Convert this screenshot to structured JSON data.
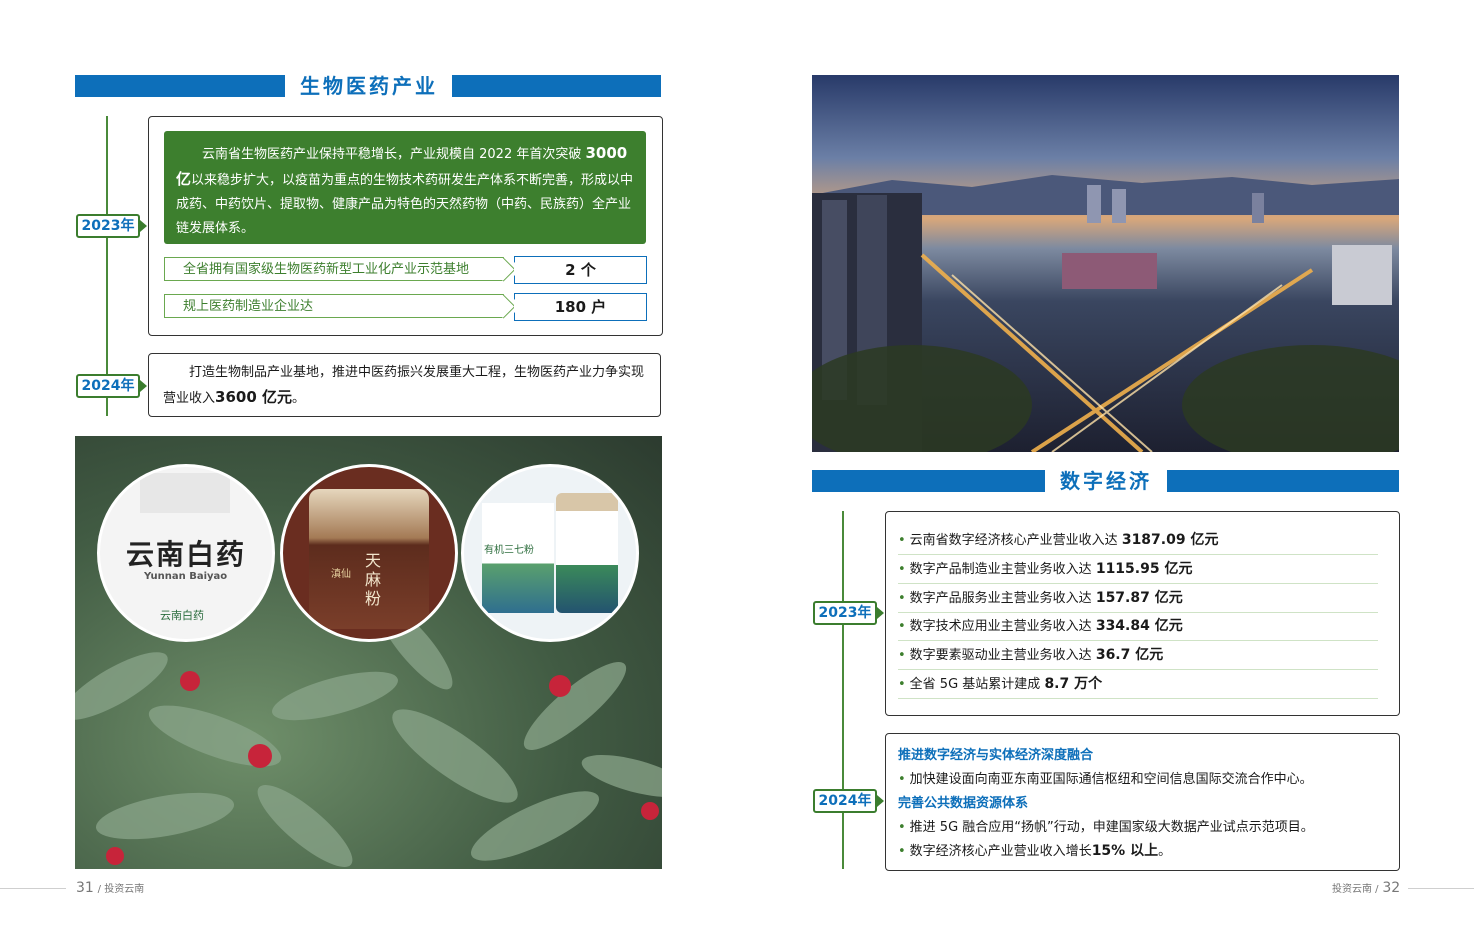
{
  "left": {
    "section_title": "生物医药产业",
    "y2023": {
      "year": "2023年",
      "paragraph": {
        "p1": "云南省生物医药产业保持平稳增长，产业规模自 2022 年首次突破",
        "p1_bold": "3000 亿",
        "p2": "以来稳步扩大，以疫苗为重点的生物技术药研发生产体系不断完善，形成以中成药、中药饮片、提取物、健康产品为特色的天然药物（中药、民族药）全产业链发展体系。"
      },
      "stats": [
        {
          "label": "全省拥有国家级生物医药新型工业化产业示范基地",
          "value": "2 个"
        },
        {
          "label": "规上医药制造业企业达",
          "value": "180 户"
        }
      ]
    },
    "y2024": {
      "year": "2024年",
      "text": "打造生物制品产业基地，推进中医药振兴发展重大工程，生物医药产业力争实现营业收入",
      "bold": "3600 亿元",
      "end": "。"
    },
    "photo": {
      "brand_cn": "云南白药",
      "brand_en": "Yunnan Baiyao",
      "brand_small": "云南白药",
      "product2_cn": "天麻粉",
      "product2_brand": "滇仙",
      "product3_cn": "有机三七粉"
    },
    "page_number": "31",
    "page_label": "/ 投资云南"
  },
  "right": {
    "section_title": "数字经济",
    "y2023": {
      "year": "2023年",
      "items": [
        {
          "text": "云南省数字经济核心产业营业收入达",
          "value": "3187.09 亿元"
        },
        {
          "text": "数字产品制造业主营业务收入达",
          "value": "1115.95 亿元"
        },
        {
          "text": "数字产品服务业主营业务收入达",
          "value": "157.87 亿元"
        },
        {
          "text": "数字技术应用业主营业务收入达",
          "value": "334.84 亿元"
        },
        {
          "text": "数字要素驱动业主营业务收入达",
          "value": "36.7 亿元"
        },
        {
          "text": "全省 5G 基站累计建成",
          "value": "8.7 万个"
        }
      ]
    },
    "y2024": {
      "year": "2024年",
      "head1": "推进数字经济与实体经济深度融合",
      "item1": "加快建设面向南亚东南亚国际通信枢纽和空间信息国际交流合作中心。",
      "head2": "完善公共数据资源体系",
      "item2": "推进 5G 融合应用“扬帆”行动，申建国家级大数据产业试点示范项目。",
      "item3": "数字经济核心产业营业收入增长",
      "item3_bold": "15% 以上",
      "item3_end": "。"
    },
    "page_number": "32",
    "page_label": "投资云南 /"
  },
  "colors": {
    "brand_blue": "#0d6fba",
    "green": "#3d7f2e"
  },
  "bullet": "•"
}
